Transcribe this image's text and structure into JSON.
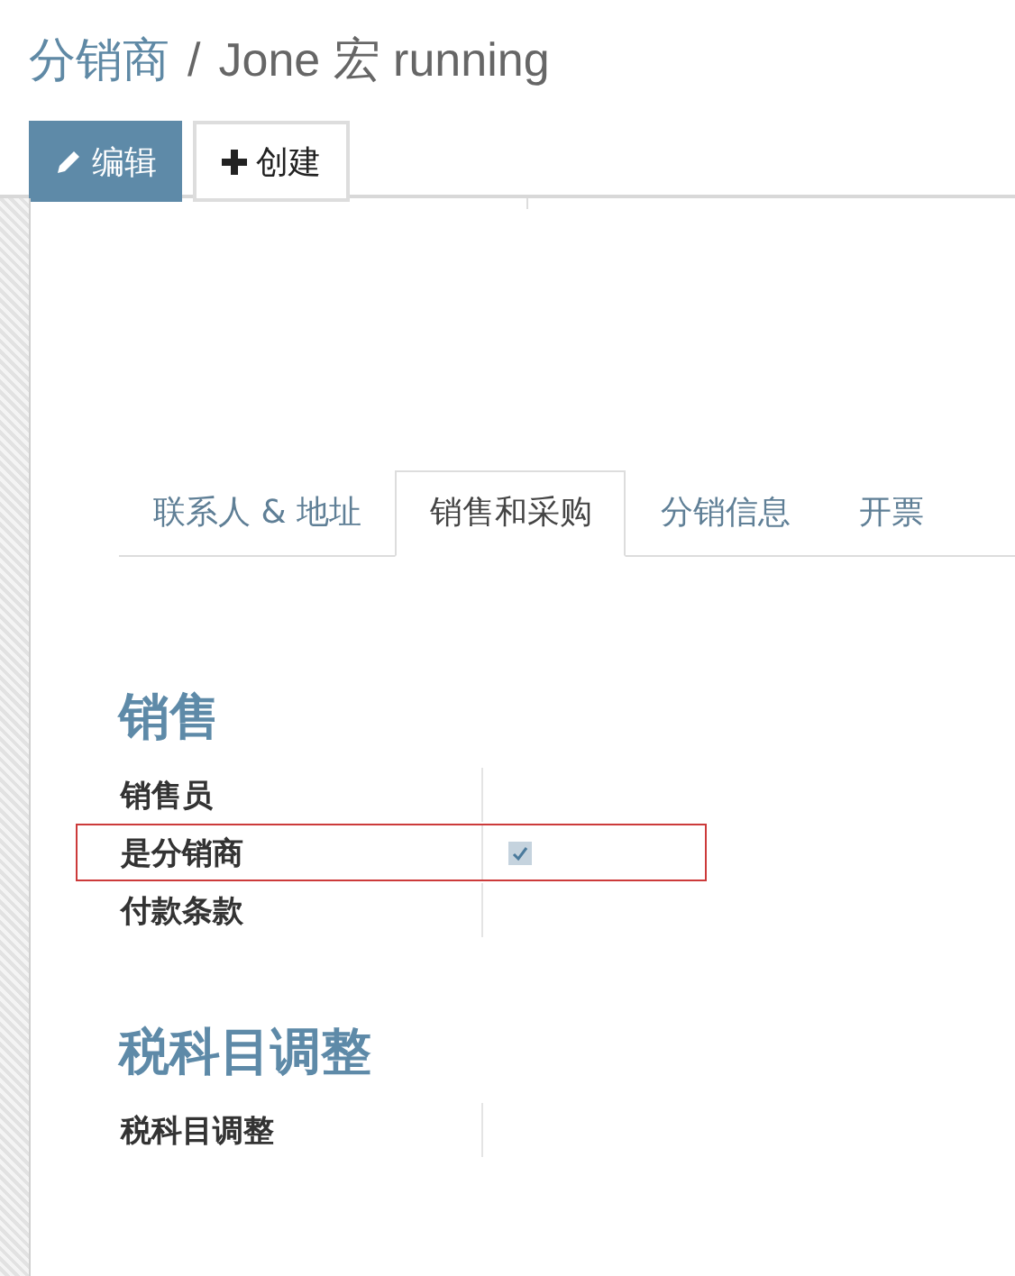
{
  "breadcrumb": {
    "parent": "分销商",
    "separator": "/",
    "current": "Jone 宏 running"
  },
  "buttons": [
    {
      "label": "编辑",
      "kind": "primary"
    },
    {
      "label": "创建",
      "kind": "secondary"
    }
  ],
  "tabs": [
    {
      "label": "联系人 & 地址",
      "selected": false
    },
    {
      "label": "销售和采购",
      "selected": true
    },
    {
      "label": "分销信息",
      "selected": false
    },
    {
      "label": "开票",
      "selected": false
    }
  ],
  "sections": [
    {
      "title": "销售",
      "fields": [
        {
          "label": "销售员",
          "kind": "text",
          "highlighted": false
        },
        {
          "label": "是分销商",
          "kind": "checkbox",
          "checked": true,
          "highlighted": true
        },
        {
          "label": "付款条款",
          "kind": "text",
          "highlighted": false
        }
      ]
    },
    {
      "title": "税科目调整",
      "fields": [
        {
          "label": "税科目调整",
          "kind": "text",
          "highlighted": false
        }
      ]
    }
  ]
}
